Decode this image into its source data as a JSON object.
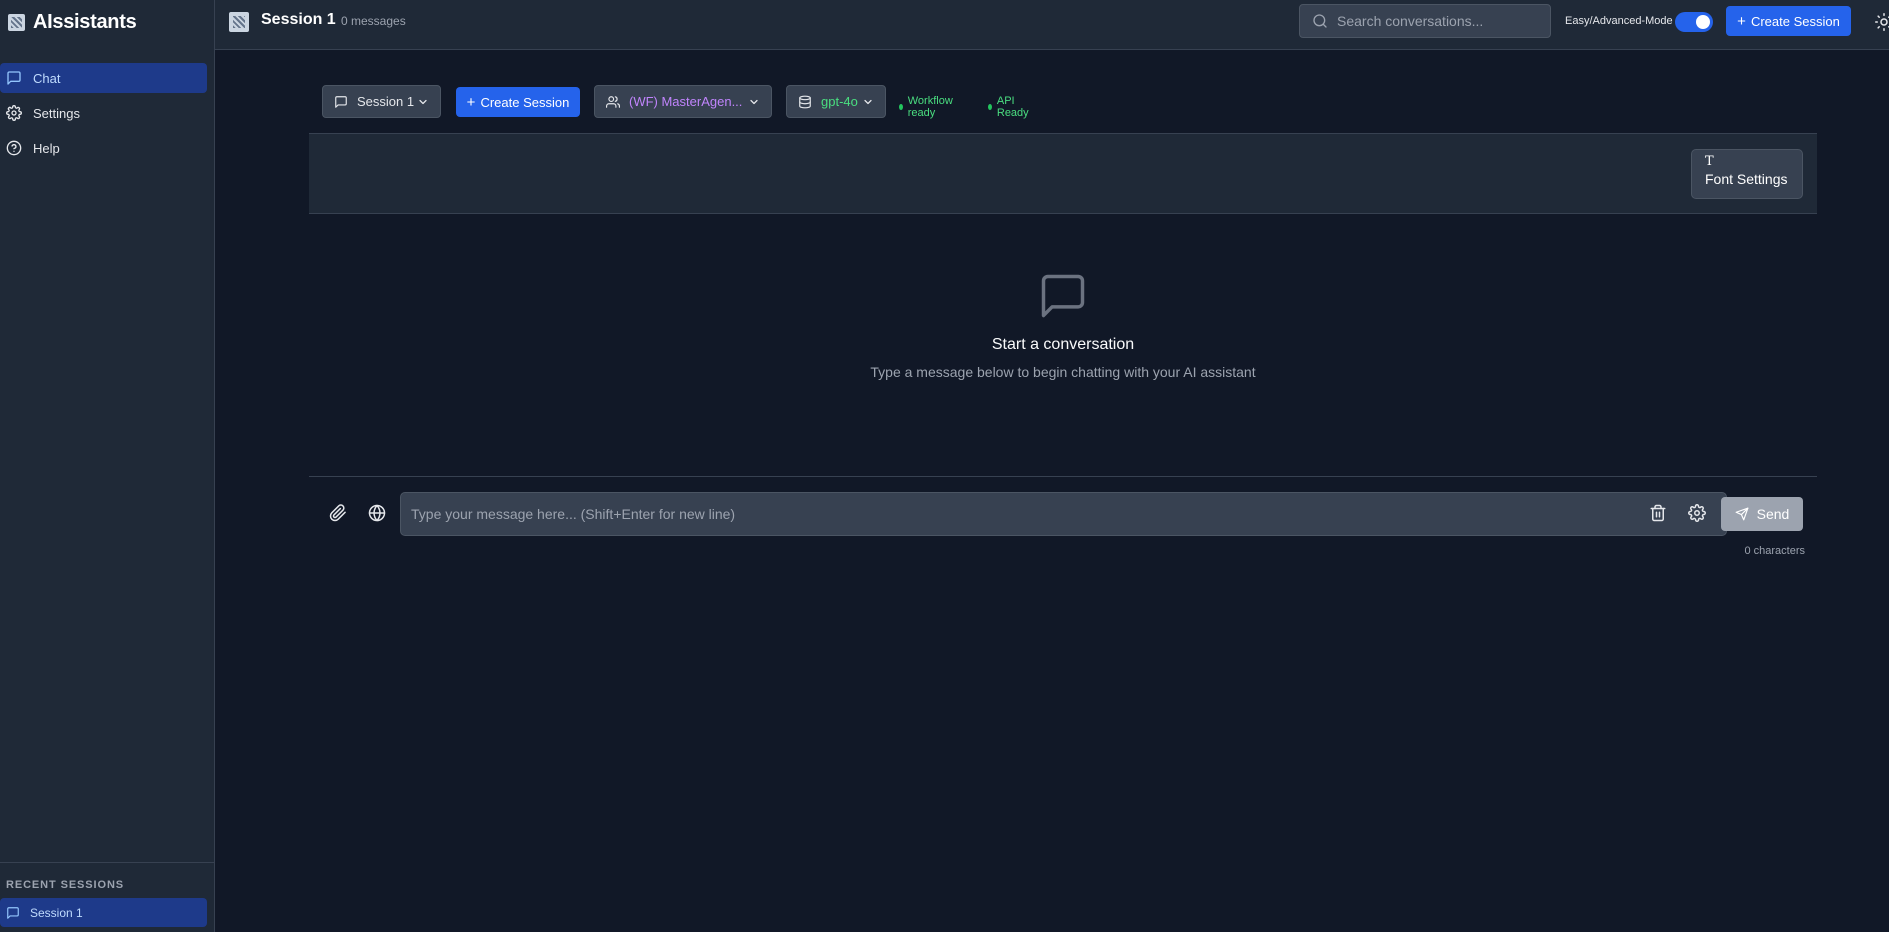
{
  "app": {
    "title": "AIssistants"
  },
  "sidebar": {
    "items": [
      {
        "label": "Chat",
        "icon": "chat-icon",
        "active": true
      },
      {
        "label": "Settings",
        "icon": "gear-icon",
        "active": false
      },
      {
        "label": "Help",
        "icon": "help-icon",
        "active": false
      }
    ],
    "recent_title": "RECENT SESSIONS",
    "recent_sessions": [
      {
        "label": "Session 1",
        "active": true
      }
    ]
  },
  "header": {
    "session_title": "Session 1",
    "message_count": "0 messages",
    "search_placeholder": "Search conversations...",
    "mode_label": "Easy/Advanced-Mode",
    "mode_toggle_on": true,
    "create_label": "Create Session"
  },
  "toolbar": {
    "session_select": "Session 1",
    "create_label": "Create Session",
    "agent_select": "(WF) MasterAgen...",
    "model_select": "gpt-4o",
    "status_workflow": "Workflow ready",
    "status_api": "API Ready"
  },
  "chat": {
    "font_settings_label": "Font Settings",
    "empty_title": "Start a conversation",
    "empty_subtitle": "Type a message below to begin chatting with your AI assistant",
    "input_placeholder": "Type your message here... (Shift+Enter for new line)",
    "send_label": "Send",
    "char_count": "0 characters"
  },
  "colors": {
    "background": "#111827",
    "panel": "#1f2937",
    "accent": "#2563eb",
    "active_nav": "#1e3a8a",
    "agent_text": "#c084fc",
    "ready_green": "#4ade80"
  }
}
